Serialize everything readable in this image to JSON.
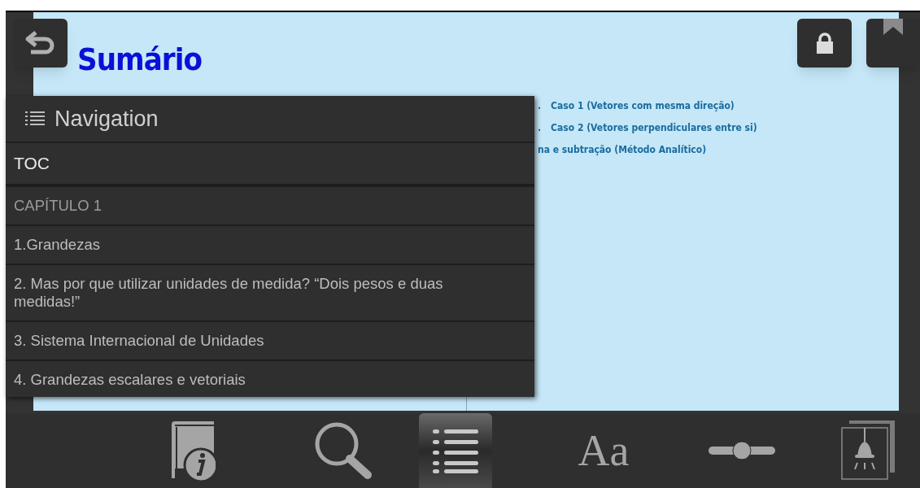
{
  "page": {
    "title": "Sumário",
    "entries": [
      {
        "marker": ".",
        "text": "Caso 1 (Vetores com mesma direção)"
      },
      {
        "marker": ".",
        "text": "Caso 2 (Vetores perpendiculares entre si)"
      },
      {
        "text": "na e subtração (Método Analítico)"
      }
    ]
  },
  "navigation": {
    "title": "Navigation",
    "section": "TOC",
    "items": [
      {
        "label": "CAPÍTULO 1",
        "kind": "heading"
      },
      {
        "label": "1.Grandezas",
        "kind": "entry"
      },
      {
        "label": "2. Mas por que utilizar unidades de medida? “Dois pesos e duas medidas!”",
        "kind": "entry"
      },
      {
        "label": "3. Sistema Internacional de Unidades",
        "kind": "entry"
      },
      {
        "label": "4. Grandezas escalares e vetoriais",
        "kind": "entry"
      }
    ]
  },
  "toolbar": [
    {
      "kind": "info",
      "selected": false
    },
    {
      "kind": "search",
      "selected": false
    },
    {
      "kind": "toc",
      "selected": true
    },
    {
      "kind": "font",
      "label": "Aa",
      "selected": false
    },
    {
      "kind": "brightness",
      "selected": false
    },
    {
      "kind": "lamp",
      "selected": false
    }
  ]
}
